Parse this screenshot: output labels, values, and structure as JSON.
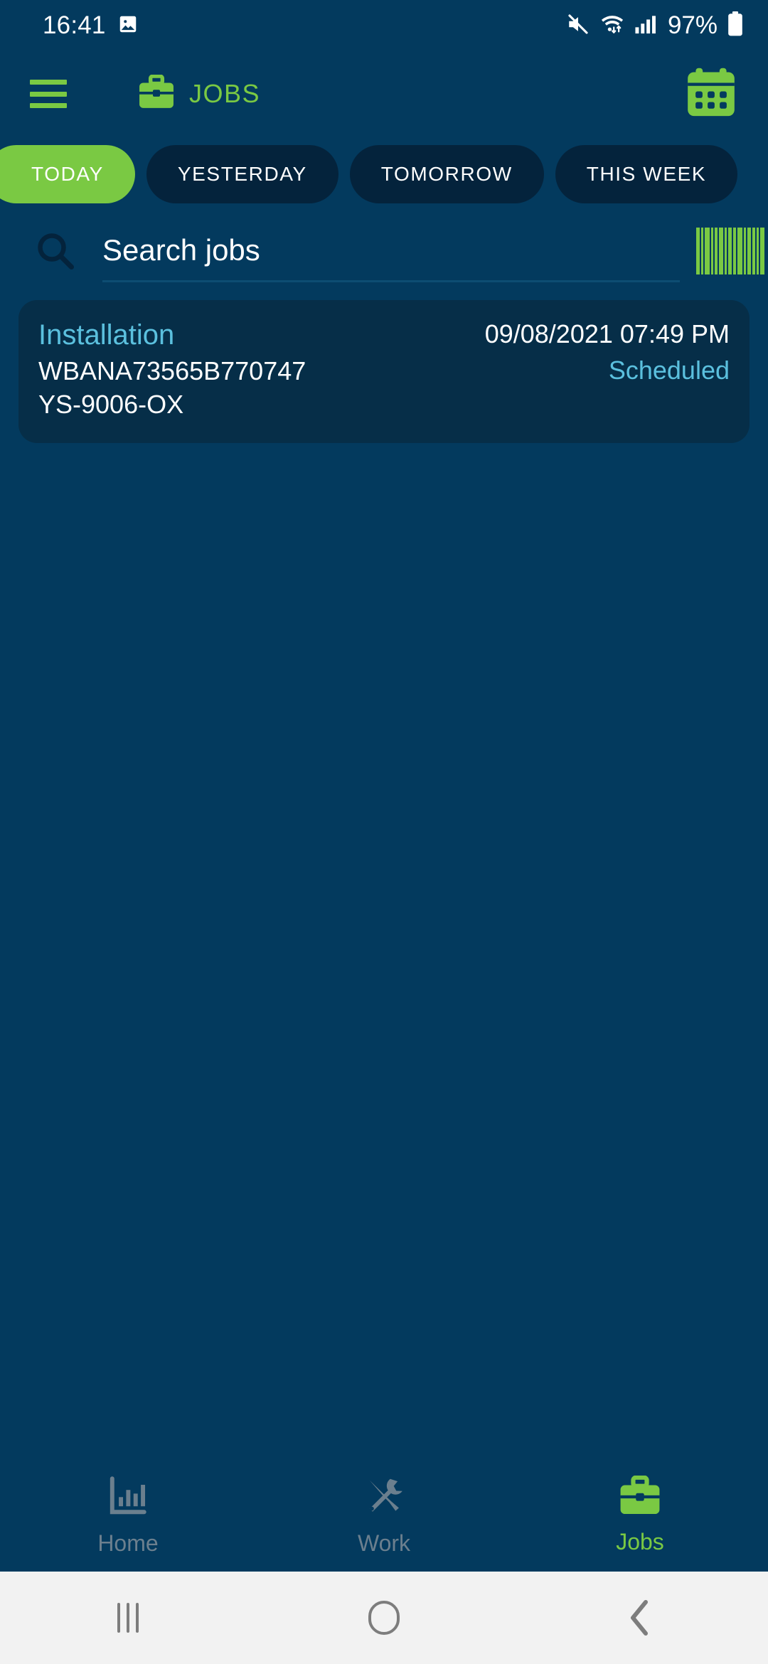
{
  "status_bar": {
    "time": "16:41",
    "battery_percent": "97%",
    "icons": [
      "image-icon",
      "mute-icon",
      "wifi-icon",
      "signal-icon",
      "battery-icon"
    ]
  },
  "header": {
    "menu_icon": "hamburger-menu-icon",
    "app_icon": "briefcase-icon",
    "title": "JOBS",
    "calendar_icon": "calendar-icon",
    "accent_color": "#7ac943"
  },
  "tabs": [
    {
      "label": "TODAY",
      "active": true
    },
    {
      "label": "YESTERDAY",
      "active": false
    },
    {
      "label": "TOMORROW",
      "active": false
    },
    {
      "label": "THIS WEEK",
      "active": false
    }
  ],
  "search": {
    "icon": "search-icon",
    "placeholder": "Search jobs",
    "value": "",
    "scan_icon": "barcode-scan-icon"
  },
  "jobs": [
    {
      "type": "Installation",
      "vin": "WBANA73565B770747",
      "reference": "YS-9006-OX",
      "datetime": "09/08/2021 07:49 PM",
      "status": "Scheduled"
    }
  ],
  "bottom_nav": [
    {
      "label": "Home",
      "icon": "bar-chart-icon",
      "active": false
    },
    {
      "label": "Work",
      "icon": "tools-icon",
      "active": false
    },
    {
      "label": "Jobs",
      "icon": "briefcase-icon",
      "active": true
    }
  ],
  "android_nav": {
    "recents": "recents-icon",
    "home": "home-icon",
    "back": "back-icon"
  },
  "colors": {
    "page_background": "#033a5e",
    "card_background": "#062e48",
    "accent_green": "#7ac943",
    "accent_blue": "#5bc0de",
    "tab_inactive": "#04233c"
  }
}
